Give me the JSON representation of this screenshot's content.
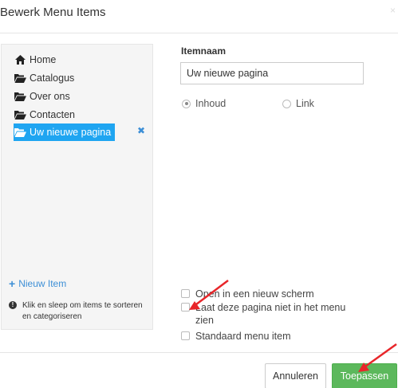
{
  "dialog": {
    "title": "Bewerk Menu Items",
    "close_glyph": "×"
  },
  "tree": {
    "items": [
      {
        "label": "Home",
        "icon": "home-icon"
      },
      {
        "label": "Catalogus",
        "icon": "folder-open-icon"
      },
      {
        "label": "Over ons",
        "icon": "folder-open-icon"
      },
      {
        "label": "Contacten",
        "icon": "folder-open-icon"
      },
      {
        "label": "Uw nieuwe pagina",
        "icon": "folder-open-icon",
        "selected": true
      }
    ],
    "remove_glyph": "✖",
    "new_item_label": "Nieuw Item",
    "hint": "Klik en sleep om items te sorteren en categoriseren"
  },
  "form": {
    "item_name_label": "Itemnaam",
    "item_name_value": "Uw nieuwe pagina",
    "radio_options": [
      {
        "label": "Inhoud",
        "checked": true
      },
      {
        "label": "Link",
        "checked": false
      }
    ],
    "checkboxes": [
      {
        "label": "Open in een nieuw scherm",
        "checked": false
      },
      {
        "label": "Laat deze pagina niet in het menu zien",
        "checked": false
      },
      {
        "label": "Standaard menu item",
        "checked": false
      }
    ]
  },
  "footer": {
    "cancel_label": "Annuleren",
    "apply_label": "Toepassen"
  },
  "colors": {
    "selected_item_bg": "#1fa5f1",
    "apply_button_bg": "#5cb85c",
    "annotation_arrow": "#e8262a",
    "link_blue": "#3d8fd6"
  }
}
